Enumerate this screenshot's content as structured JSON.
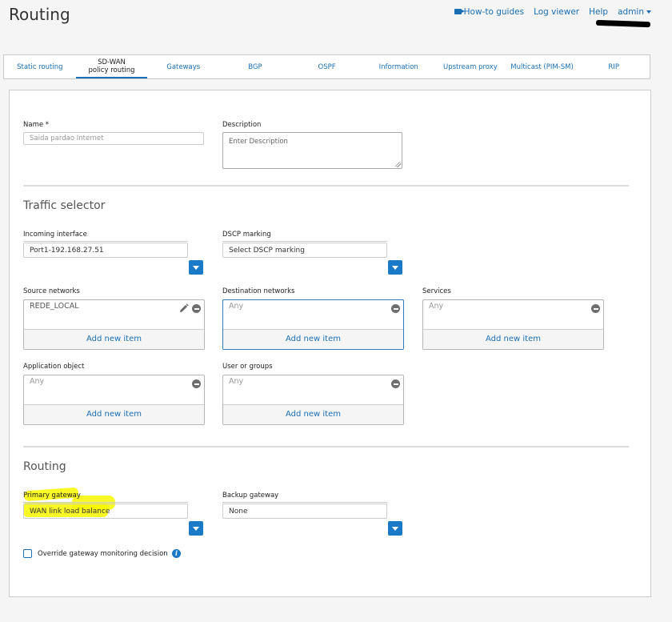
{
  "page": {
    "title": "Routing"
  },
  "topnav": {
    "how_to": "How-to guides",
    "log_viewer": "Log viewer",
    "help": "Help",
    "admin": "admin"
  },
  "tabs": [
    {
      "label": "Static routing"
    },
    {
      "label": "SD-WAN policy routing",
      "active": true
    },
    {
      "label": "Gateways"
    },
    {
      "label": "BGP"
    },
    {
      "label": "OSPF"
    },
    {
      "label": "Information"
    },
    {
      "label": "Upstream proxy"
    },
    {
      "label": "Multicast (PIM-SM)"
    },
    {
      "label": "RIP"
    }
  ],
  "form": {
    "name": {
      "label": "Name *",
      "value": "Saida pardao Internet"
    },
    "description": {
      "label": "Description",
      "placeholder": "Enter Description"
    },
    "traffic_selector": {
      "title": "Traffic selector",
      "incoming_interface": {
        "label": "Incoming interface",
        "value": "Port1-192.168.27.51"
      },
      "dscp_marking": {
        "label": "DSCP marking",
        "value": "Select DSCP marking"
      },
      "source_networks": {
        "label": "Source networks",
        "items": [
          "REDE_LOCAL"
        ],
        "add": "Add new item"
      },
      "destination_networks": {
        "label": "Destination networks",
        "items": [
          "Any"
        ],
        "add": "Add new item"
      },
      "services": {
        "label": "Services",
        "items": [
          "Any"
        ],
        "add": "Add new item"
      },
      "application_object": {
        "label": "Application object",
        "items": [
          "Any"
        ],
        "add": "Add new item"
      },
      "user_or_groups": {
        "label": "User or groups",
        "items": [
          "Any"
        ],
        "add": "Add new item"
      }
    },
    "routing": {
      "title": "Routing",
      "primary_gateway": {
        "label": "Primary gateway",
        "value": "WAN link load balance"
      },
      "backup_gateway": {
        "label": "Backup gateway",
        "value": "None"
      },
      "override": {
        "label": "Override gateway monitoring decision",
        "checked": false
      }
    }
  },
  "colors": {
    "accent": "#1a6fb5",
    "highlight": "#f8f800"
  }
}
